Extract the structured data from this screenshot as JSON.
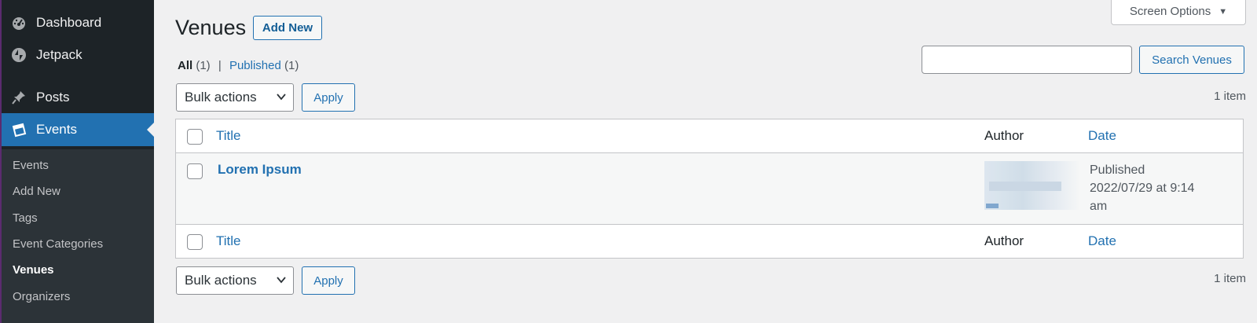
{
  "sidebar": {
    "items": [
      {
        "label": "Dashboard",
        "icon": "dashboard-icon"
      },
      {
        "label": "Jetpack",
        "icon": "jetpack-icon"
      },
      {
        "label": "Posts",
        "icon": "pin-icon"
      },
      {
        "label": "Events",
        "icon": "calendar-icon"
      }
    ],
    "submenu": [
      "Events",
      "Add New",
      "Tags",
      "Event Categories",
      "Venues",
      "Organizers"
    ]
  },
  "header": {
    "screen_options": "Screen Options",
    "title": "Venues",
    "add_new": "Add New"
  },
  "filters": {
    "all_label": "All",
    "all_count": "(1)",
    "separator": "|",
    "published_label": "Published",
    "published_count": "(1)"
  },
  "search": {
    "value": "",
    "button": "Search Venues"
  },
  "bulk": {
    "selected": "Bulk actions",
    "apply": "Apply",
    "count": "1 item"
  },
  "table": {
    "columns": {
      "title": "Title",
      "author": "Author",
      "date": "Date"
    },
    "rows": [
      {
        "title": "Lorem Ipsum",
        "status": "Published",
        "date_line": "2022/07/29 at 9:14",
        "date_suffix": "am"
      }
    ]
  },
  "colors": {
    "accent": "#2271b1",
    "sidebar_bg": "#1d2327",
    "page_bg": "#f0f0f1"
  }
}
